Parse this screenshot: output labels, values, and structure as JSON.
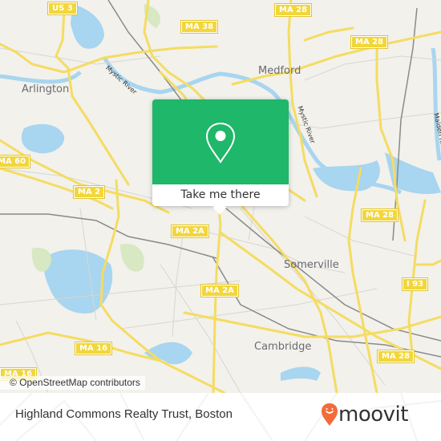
{
  "map": {
    "places": [
      {
        "name": "Arlington"
      },
      {
        "name": "Medford"
      },
      {
        "name": "Somerville"
      },
      {
        "name": "Cambridge"
      }
    ],
    "rivers": [
      {
        "name": "Mystic River"
      },
      {
        "name": "Mystic River"
      },
      {
        "name": "Malden River"
      }
    ],
    "shields": [
      {
        "label": "US 3"
      },
      {
        "label": "MA 38"
      },
      {
        "label": "MA 28"
      },
      {
        "label": "MA 28"
      },
      {
        "label": "MA 60"
      },
      {
        "label": "MA 2"
      },
      {
        "label": "MA 2A"
      },
      {
        "label": "MA 2A"
      },
      {
        "label": "MA 28"
      },
      {
        "label": "I 93"
      },
      {
        "label": "MA 16"
      },
      {
        "label": "MA 16"
      },
      {
        "label": "MA 28"
      }
    ],
    "attribution": "© OpenStreetMap contributors",
    "colors": {
      "land": "#f2f1ec",
      "water": "#a8d5ef",
      "road": "#f5dc61",
      "park": "#cfe6b4"
    }
  },
  "popup": {
    "action_label": "Take me there",
    "icon": "map-pin-icon",
    "accent_color": "#1fb769"
  },
  "footer": {
    "title": "Highland Commons Realty Trust, Boston",
    "brand": "moovit",
    "brand_icon": "moovit-pin-logo",
    "brand_color": "#f26b3a"
  }
}
